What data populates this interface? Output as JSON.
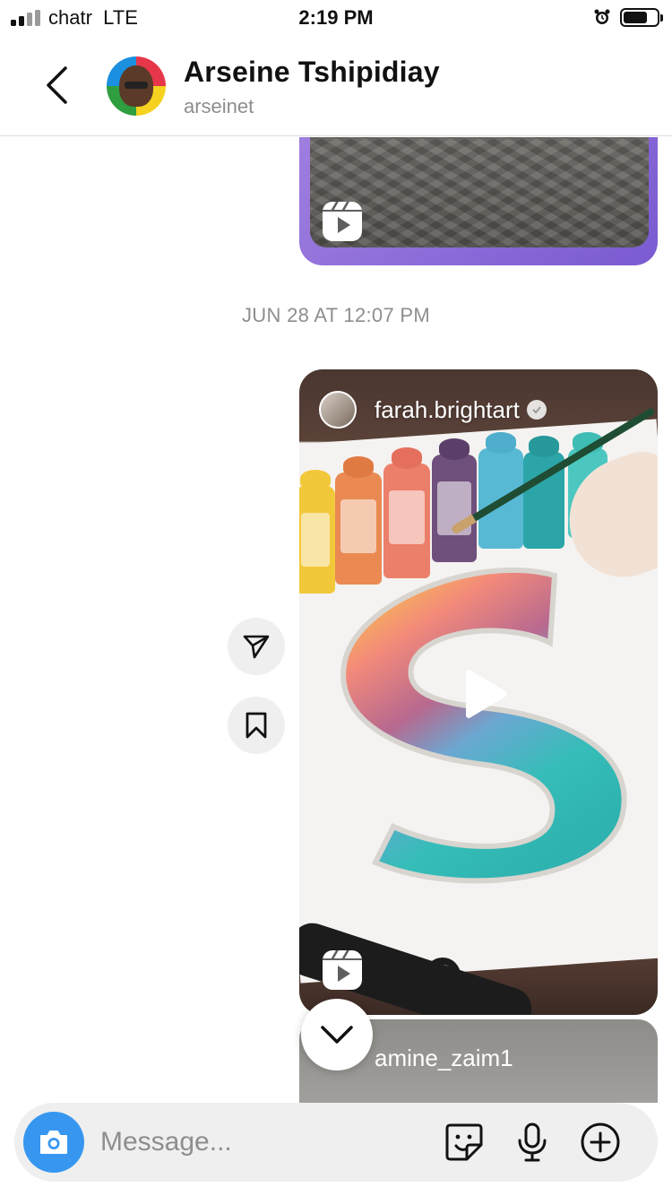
{
  "status_bar": {
    "carrier": "chatr",
    "network": "LTE",
    "time": "2:19 PM",
    "battery_percent": 70
  },
  "header": {
    "name": "Arseine Tshipidiay",
    "username": "arseinet"
  },
  "conversation": {
    "timestamp": "JUN 28 AT 12:07 PM",
    "reel": {
      "author": "farah.brightart",
      "verified": true
    },
    "next_reel": {
      "author": "amine_zaim1"
    }
  },
  "composer": {
    "placeholder": "Message..."
  },
  "colors": {
    "accent_blue": "#3797f0",
    "reel_border_purple": "#8a6ad8",
    "muted_text": "#8e8e8e"
  }
}
